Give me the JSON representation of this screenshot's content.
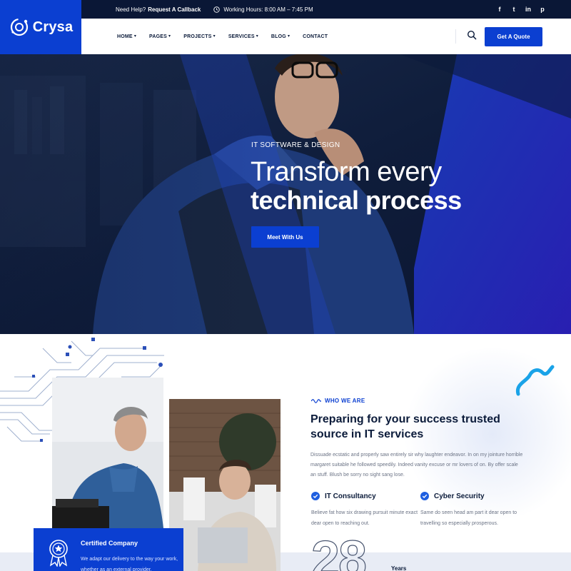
{
  "brand": {
    "name": "Crysa",
    "accent": "#0b3fd1",
    "dark": "#0a1736"
  },
  "topbar": {
    "help_prefix": "Need Help?",
    "help_link": "Request A Callback",
    "hours": "Working Hours: 8:00 AM – 7:45 PM",
    "social": [
      "f",
      "t",
      "in",
      "p"
    ],
    "social_icons": [
      "facebook-icon",
      "twitter-icon",
      "linkedin-icon",
      "pinterest-icon"
    ]
  },
  "nav": {
    "items": [
      {
        "label": "HOME",
        "has_dropdown": true
      },
      {
        "label": "PAGES",
        "has_dropdown": true
      },
      {
        "label": "PROJECTS",
        "has_dropdown": true
      },
      {
        "label": "SERVICES",
        "has_dropdown": true
      },
      {
        "label": "BLOG",
        "has_dropdown": true
      },
      {
        "label": "CONTACT",
        "has_dropdown": false
      }
    ],
    "quote_label": "Get A Quote"
  },
  "hero": {
    "eyebrow": "IT SOFTWARE & DESIGN",
    "title_light": "Transform every",
    "title_bold": "technical process",
    "cta": "Meet With Us"
  },
  "about": {
    "label": "WHO WE ARE",
    "title": "Preparing for your success trusted source in IT services",
    "description": "Dissuade ecstatic and properly saw entirely sir why laughter endeavor. In on my jointure horrible margaret suitable he followed speedily. Indeed vanity excuse or mr lovers of on. By offer scale an stuff. Blush be sorry no sight sang lose.",
    "features": [
      {
        "title": "IT Consultancy",
        "text": "Believe fat how six drawing pursuit minute exact dear open to reaching out."
      },
      {
        "title": "Cyber Security",
        "text": "Same do seen head am part it dear open to travelling so especially prosperous."
      }
    ],
    "certified": {
      "title": "Certified Company",
      "text": "We adapt our delivery to the way your work, whether as an external provider."
    },
    "years_number": "28",
    "years_label": "Years"
  }
}
